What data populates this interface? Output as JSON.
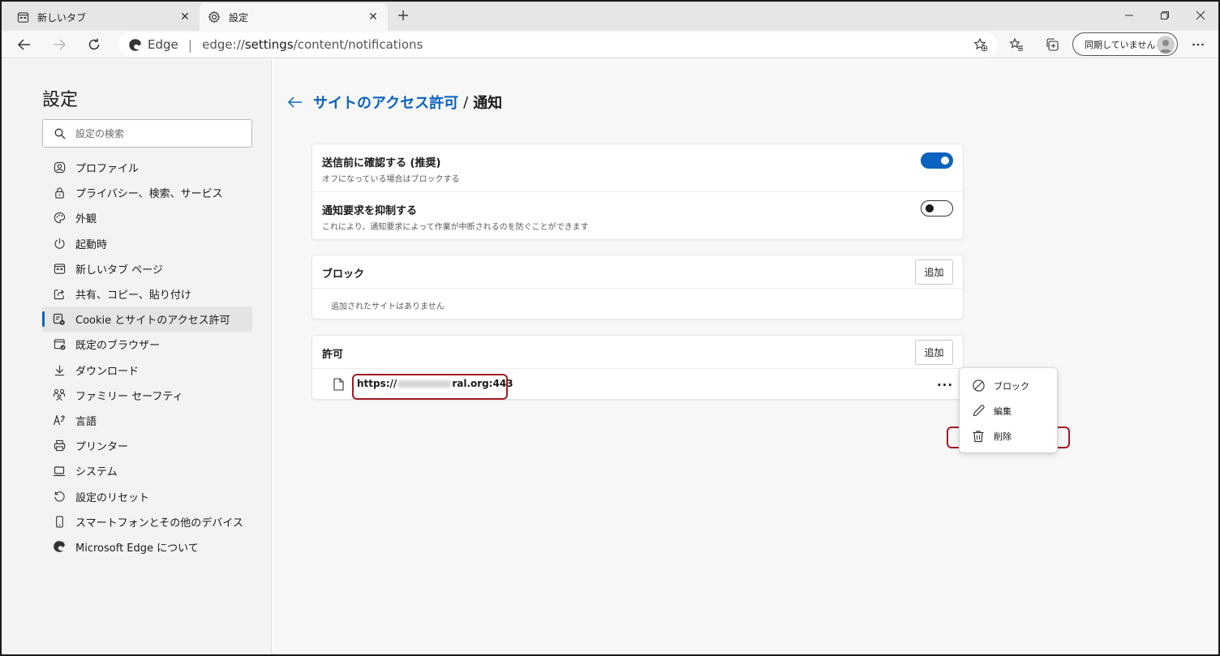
{
  "tabs": [
    {
      "title": "新しいタブ",
      "icon": "new-tab-page-icon"
    },
    {
      "title": "設定",
      "icon": "gear-icon"
    }
  ],
  "address_bar": {
    "brand": "Edge",
    "url_prefix": "edge://",
    "url_bold": "settings",
    "url_suffix": "/content/notifications"
  },
  "sync_button": {
    "label": "同期していません"
  },
  "sidebar": {
    "title": "設定",
    "search_placeholder": "設定の検索",
    "items": [
      {
        "label": "プロファイル",
        "icon": "profile-icon"
      },
      {
        "label": "プライバシー、検索、サービス",
        "icon": "lock-icon"
      },
      {
        "label": "外観",
        "icon": "palette-icon"
      },
      {
        "label": "起動時",
        "icon": "power-icon"
      },
      {
        "label": "新しいタブ ページ",
        "icon": "new-tab-page-icon"
      },
      {
        "label": "共有、コピー、貼り付け",
        "icon": "share-icon"
      },
      {
        "label": "Cookie とサイトのアクセス許可",
        "icon": "cookie-permissions-icon",
        "selected": true
      },
      {
        "label": "既定のブラウザー",
        "icon": "default-browser-icon"
      },
      {
        "label": "ダウンロード",
        "icon": "download-icon"
      },
      {
        "label": "ファミリー セーフティ",
        "icon": "family-icon"
      },
      {
        "label": "言語",
        "icon": "language-icon"
      },
      {
        "label": "プリンター",
        "icon": "printer-icon"
      },
      {
        "label": "システム",
        "icon": "laptop-icon"
      },
      {
        "label": "設定のリセット",
        "icon": "reset-icon"
      },
      {
        "label": "スマートフォンとその他のデバイス",
        "icon": "phone-icon"
      },
      {
        "label": "Microsoft Edge について",
        "icon": "edge-logo-icon"
      }
    ]
  },
  "main": {
    "breadcrumb_link": "サイトのアクセス許可",
    "breadcrumb_sep": "/",
    "breadcrumb_current": "通知",
    "settings": [
      {
        "title": "送信前に確認する (推奨)",
        "description": "オフになっている場合はブロックする",
        "enabled": true
      },
      {
        "title": "通知要求を抑制する",
        "description": "これにより、通知要求によって作業が中断されるのを防ぐことができます",
        "enabled": false
      }
    ],
    "block_section": {
      "title": "ブロック",
      "add_label": "追加",
      "empty_text": "追加されたサイトはありません"
    },
    "allow_section": {
      "title": "許可",
      "add_label": "追加",
      "site": {
        "url_start": "https://",
        "url_end": "ral.org:443"
      }
    },
    "more_label": "···"
  },
  "context_menu": {
    "items": [
      {
        "label": "ブロック",
        "icon": "block-icon"
      },
      {
        "label": "編集",
        "icon": "pencil-icon"
      },
      {
        "label": "削除",
        "icon": "trash-icon"
      }
    ]
  },
  "colors": {
    "accent": "#0a63be",
    "highlight": "#a31a22"
  }
}
